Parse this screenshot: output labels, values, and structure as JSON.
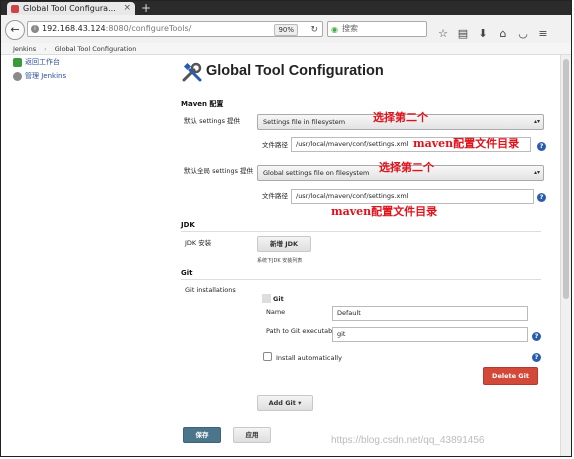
{
  "browser": {
    "tab_title": "Global Tool Configura...",
    "url_host": "192.168.43.124",
    "url_rest": ":8080/configureTools/",
    "zoom": "90%",
    "search_placeholder": "搜索"
  },
  "breadcrumb": {
    "item1": "Jenkins",
    "item2": "Global Tool Configuration"
  },
  "sidebar": {
    "back": "返回工作台",
    "manage": "管理 Jenkins"
  },
  "page": {
    "title": "Global Tool Configuration"
  },
  "maven": {
    "header": "Maven 配置",
    "default_settings_label": "默认 settings 提供",
    "default_settings_value": "Settings file in filesystem",
    "file_path_label": "文件路径",
    "file_path_value": "/usr/local/maven/conf/settings.xml",
    "global_settings_label": "默认全局 settings 提供",
    "global_settings_value": "Global settings file on filesystem",
    "global_file_path_label": "文件路径",
    "global_file_path_value": "/usr/local/maven/conf/settings.xml"
  },
  "annotations": {
    "a1": "选择第二个",
    "a2": "maven配置文件目录",
    "a3": "选择第二个",
    "a4": "maven配置文件目录"
  },
  "jdk": {
    "header": "JDK",
    "install_label": "JDK 安装",
    "add_button": "新增 JDK",
    "note": "系统下JDK 安装列表"
  },
  "git": {
    "header": "Git",
    "installations_label": "Git installations",
    "item_title": "Git",
    "name_label": "Name",
    "name_value": "Default",
    "path_label": "Path to Git executable",
    "path_value": "git",
    "install_auto_label": "Install automatically",
    "delete_button": "Delete Git",
    "add_button": "Add Git"
  },
  "actions": {
    "save": "保存",
    "apply": "应用"
  },
  "watermark": "https://blog.csdn.net/qq_43891456"
}
